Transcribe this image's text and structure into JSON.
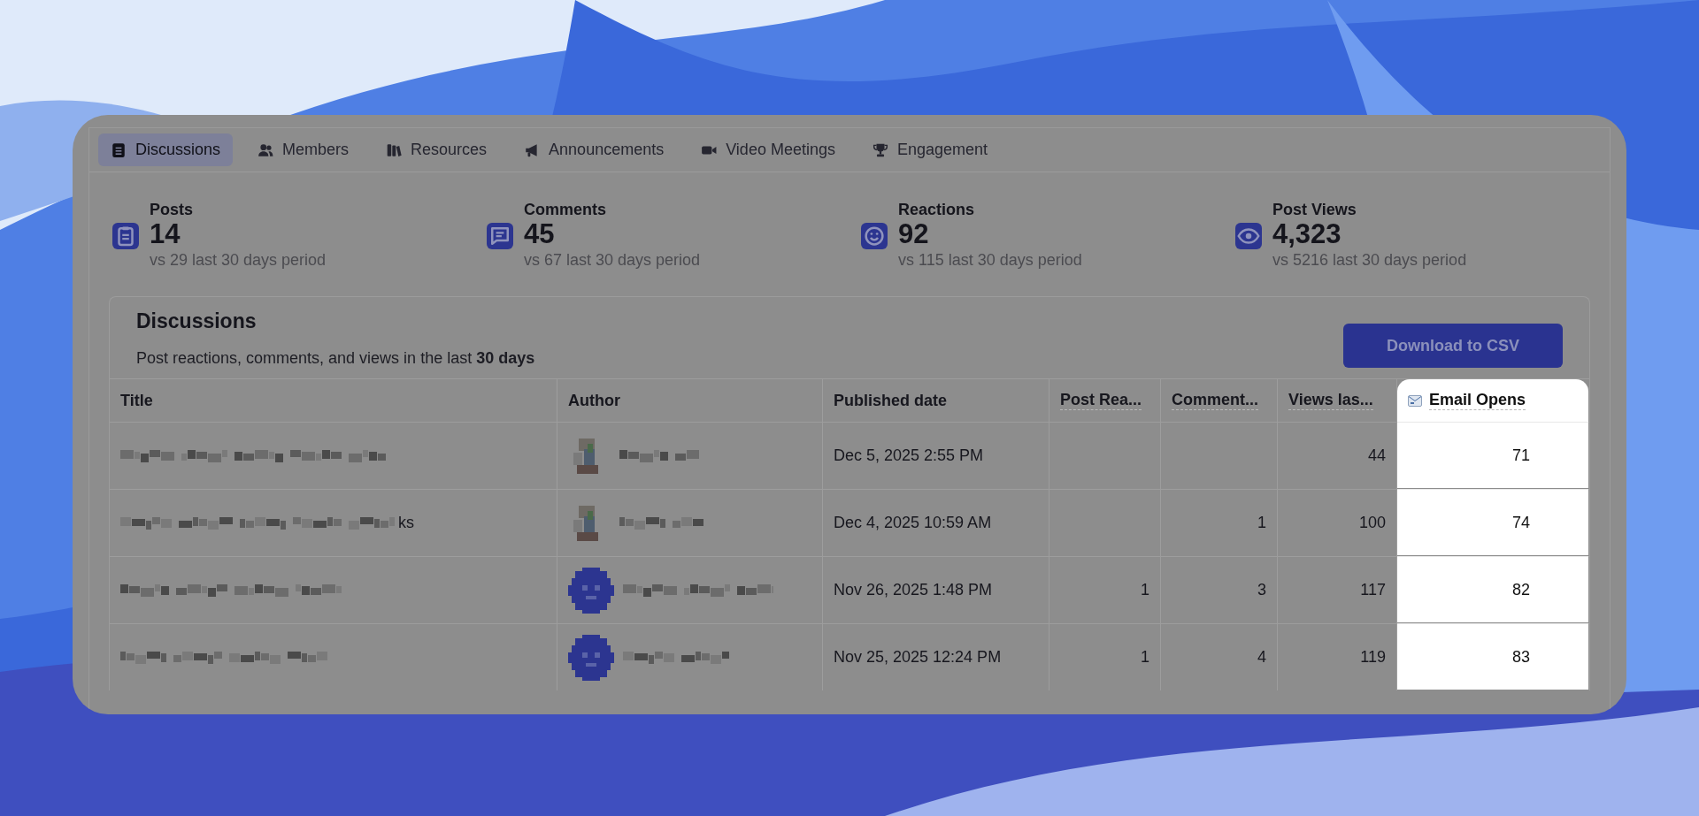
{
  "tabs": [
    {
      "label": "Discussions",
      "selected": true
    },
    {
      "label": "Members",
      "selected": false
    },
    {
      "label": "Resources",
      "selected": false
    },
    {
      "label": "Announcements",
      "selected": false
    },
    {
      "label": "Video Meetings",
      "selected": false
    },
    {
      "label": "Engagement",
      "selected": false
    }
  ],
  "stats": [
    {
      "label": "Posts",
      "value": "14",
      "comparison": "vs 29 last 30 days period"
    },
    {
      "label": "Comments",
      "value": "45",
      "comparison": "vs 67 last 30 days period"
    },
    {
      "label": "Reactions",
      "value": "92",
      "comparison": "vs 115 last 30 days period"
    },
    {
      "label": "Post Views",
      "value": "4,323",
      "comparison": "vs 5216 last 30 days period"
    }
  ],
  "panel": {
    "title": "Discussions",
    "subtitle": "Post reactions, comments, and views in the last **30 days**",
    "download_button": "Download to CSV"
  },
  "table": {
    "columns": [
      "Title",
      "Author",
      "Published date",
      "Post Rea...",
      "Comment...",
      "Views las...",
      "Email Opens"
    ],
    "rows": [
      {
        "kind": "picture",
        "published": "Dec 5, 2025 2:55 PM",
        "views": "44",
        "email_opens": "71"
      },
      {
        "kind": "picture",
        "title_tail": "ks",
        "published": "Dec 4, 2025 10:59 AM",
        "comments": "1",
        "views": "100",
        "email_opens": "74"
      },
      {
        "kind": "default",
        "published": "Nov 26, 2025 1:48 PM",
        "reactions": "1",
        "comments": "3",
        "views": "117",
        "email_opens": "82"
      },
      {
        "kind": "default",
        "published": "Nov 25, 2025 12:24 PM",
        "reactions": "1",
        "comments": "4",
        "views": "119",
        "email_opens": "83"
      }
    ]
  }
}
